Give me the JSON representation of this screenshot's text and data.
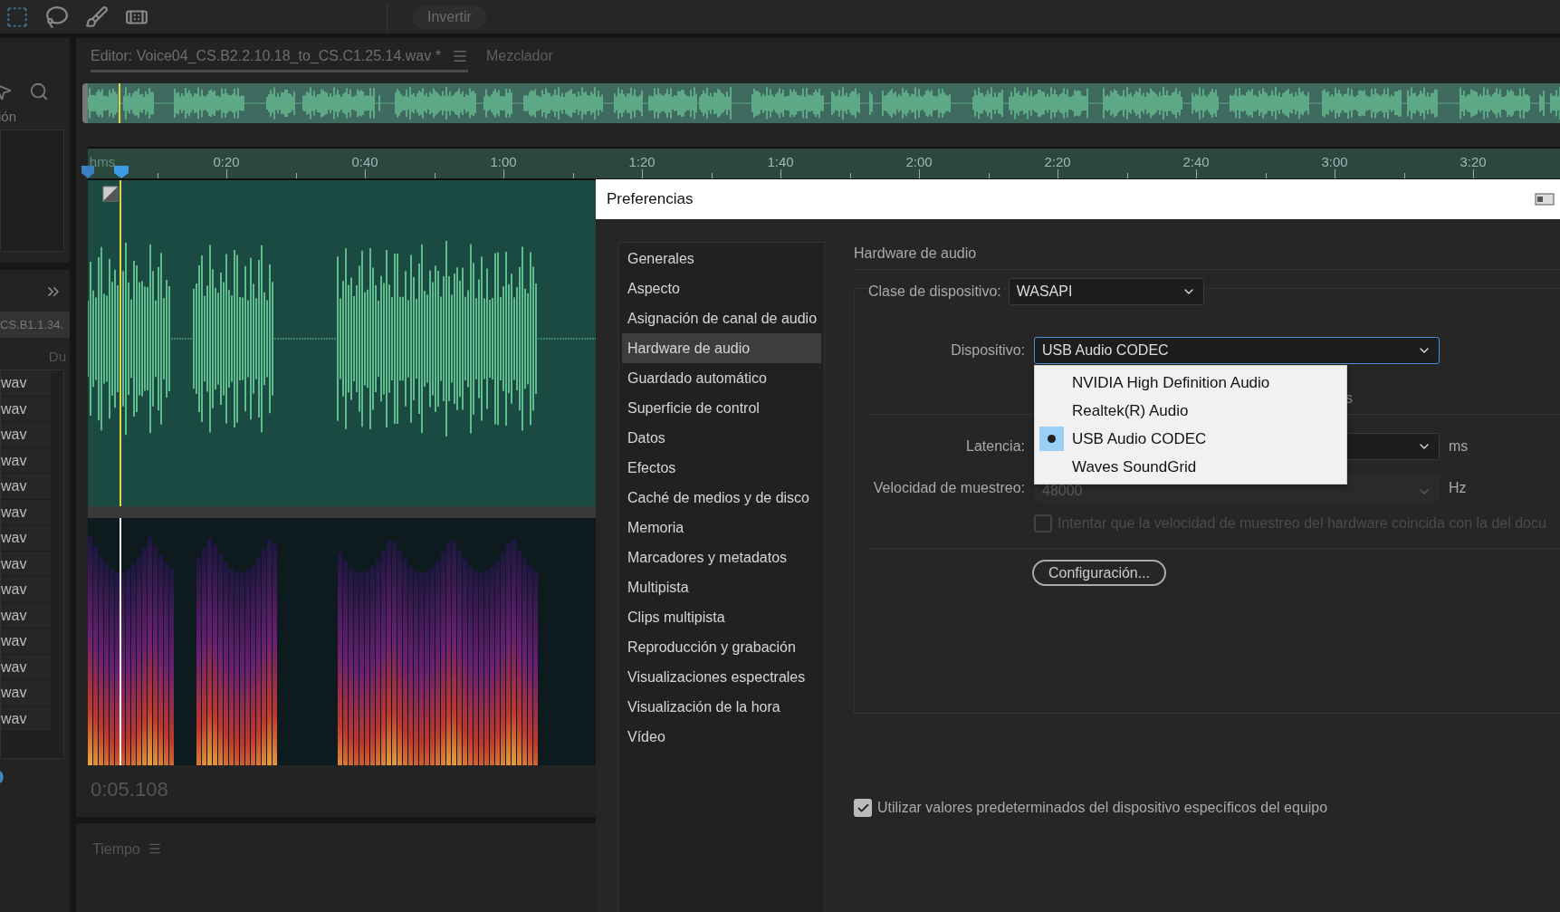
{
  "toolbar": {
    "button": "Invertir"
  },
  "left_panel": {
    "label": "ión",
    "file_header": "CS.B1.1.34.",
    "column_2": "Du",
    "files": [
      "wav",
      "wav",
      "wav",
      "wav",
      "wav",
      "wav",
      "wav",
      "wav",
      "wav",
      "wav",
      "wav",
      "wav",
      "wav",
      "wav"
    ]
  },
  "editor": {
    "tabs": [
      {
        "label": "Editor: Voice04_CS.B2.2.10.18_to_CS.C1.25.14.wav *",
        "selected": true
      },
      {
        "label": "Mezclador",
        "selected": false
      }
    ],
    "ruler": {
      "unit": "hms",
      "ticks": [
        "0:20",
        "0:40",
        "1:00",
        "1:20",
        "1:40",
        "2:00",
        "2:20",
        "2:40",
        "3:00",
        "3:20"
      ]
    },
    "time": "0:05.108"
  },
  "time_panel": {
    "title": "Tiempo"
  },
  "dialog": {
    "title": "Preferencias",
    "categories": [
      {
        "label": "Generales",
        "selected": false
      },
      {
        "label": "Aspecto",
        "selected": false
      },
      {
        "label": "Asignación de canal de audio",
        "selected": false
      },
      {
        "label": "Hardware de audio",
        "selected": true
      },
      {
        "label": "Guardado automático",
        "selected": false
      },
      {
        "label": "Superficie de control",
        "selected": false
      },
      {
        "label": "Datos",
        "selected": false
      },
      {
        "label": "Efectos",
        "selected": false
      },
      {
        "label": "Caché de medios y de disco",
        "selected": false
      },
      {
        "label": "Memoria",
        "selected": false
      },
      {
        "label": "Marcadores y metadatos",
        "selected": false
      },
      {
        "label": "Multipista",
        "selected": false
      },
      {
        "label": "Clips multipista",
        "selected": false
      },
      {
        "label": "Reproducción y grabación",
        "selected": false
      },
      {
        "label": "Visualizaciones espectrales",
        "selected": false
      },
      {
        "label": "Visualización de la hora",
        "selected": false
      },
      {
        "label": "Vídeo",
        "selected": false
      }
    ],
    "section": "Hardware de audio",
    "device_class": {
      "label": "Clase de dispositivo:",
      "value": "WASAPI"
    },
    "device": {
      "label": "Dispositivo:",
      "value": "USB Audio CODEC",
      "expanded": true,
      "options": [
        {
          "label": "NVIDIA High Definition Audio",
          "selected": false
        },
        {
          "label": "Realtek(R) Audio",
          "selected": false
        },
        {
          "label": "USB Audio CODEC",
          "selected": true
        },
        {
          "label": "Waves SoundGrid",
          "selected": false
        }
      ]
    },
    "covered_text": "s",
    "latency": {
      "label": "Latencia:",
      "unit": "ms"
    },
    "sample_rate": {
      "label": "Velocidad de muestreo:",
      "value": "48000",
      "unit": "Hz",
      "disabled": true
    },
    "match_rate": {
      "label": "Intentar que la velocidad de muestreo del hardware coincida con la del docu",
      "checked": false,
      "disabled": true
    },
    "settings_button": "Configuración...",
    "use_defaults": {
      "label": "Utilizar valores predeterminados del dispositivo específicos del equipo",
      "checked": true
    }
  }
}
